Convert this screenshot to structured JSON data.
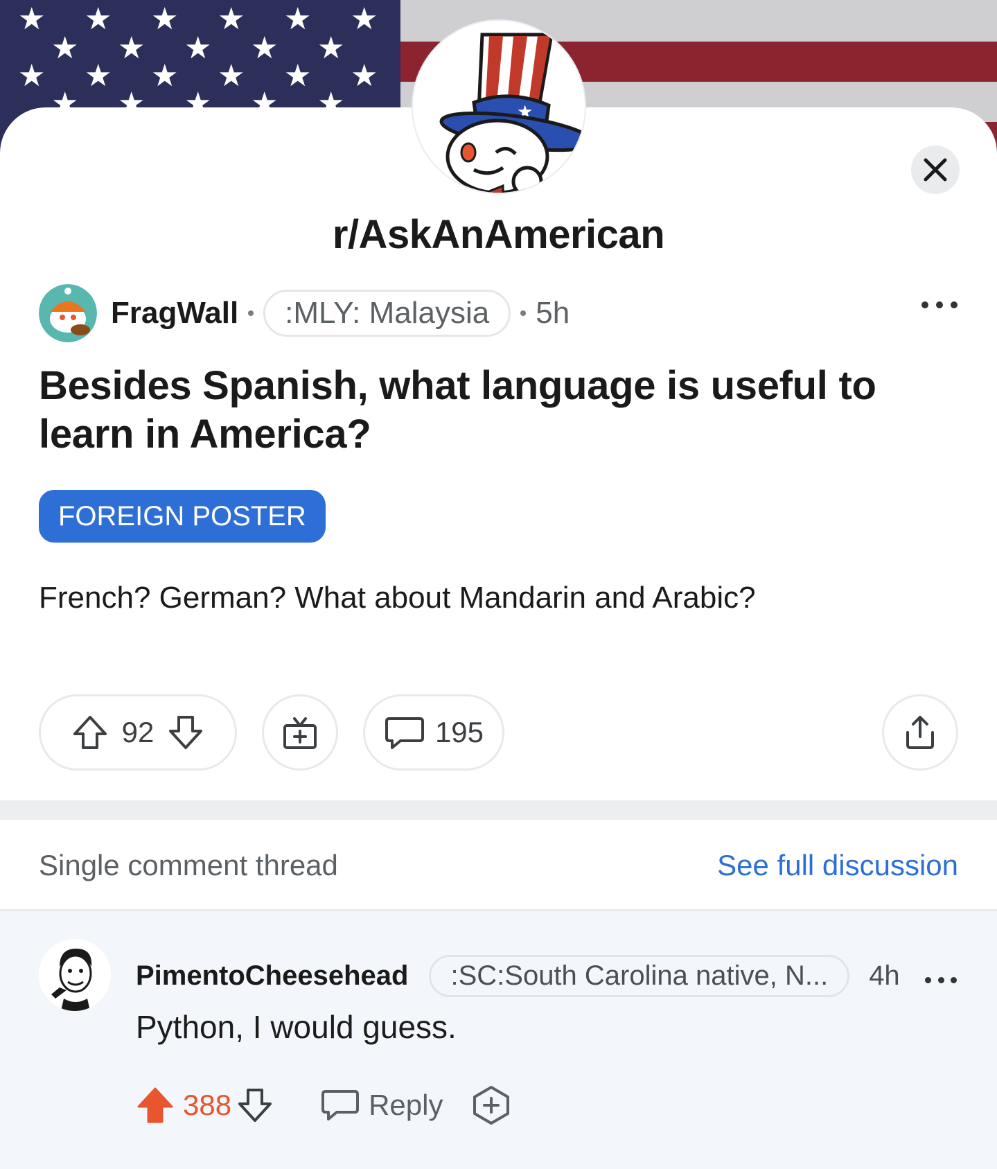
{
  "banner": {
    "image": "us-flag-banner",
    "colors": {
      "canton": "#2b2f5a",
      "red": "#8c2430",
      "white": "#cfcfd1"
    }
  },
  "subreddit": {
    "name": "r/AskAnAmerican",
    "avatar": "uncle-sam-snoo-avatar"
  },
  "post": {
    "author": "FragWall",
    "author_flair": ":MLY: Malaysia",
    "age": "5h",
    "title": "Besides Spanish, what language is useful to learn in America?",
    "flair": "FOREIGN POSTER",
    "body": "French? German? What about Mandarin and Arabic?",
    "score": "92",
    "comments": "195"
  },
  "thread": {
    "label": "Single comment thread",
    "see_full": "See full discussion"
  },
  "comment": {
    "author": "PimentoCheesehead",
    "author_flair": ":SC:South Carolina native, N...",
    "age": "4h",
    "body": "Python, I would guess.",
    "score": "388",
    "reply_label": "Reply"
  },
  "colors": {
    "accent_blue": "#2d6fd6",
    "upvote_orange": "#e8552f"
  }
}
